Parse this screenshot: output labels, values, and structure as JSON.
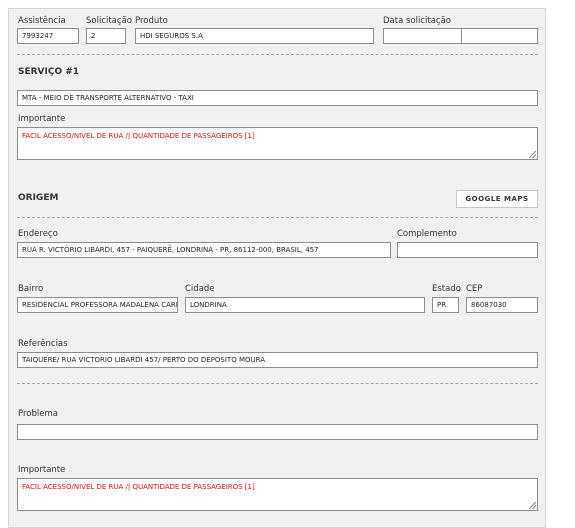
{
  "header": {
    "assistencia_label": "Assistência",
    "assistencia_value": "7993247",
    "solicitacao_label": "Solicitação",
    "solicitacao_value": "2",
    "produto_label": "Produto",
    "produto_value": "HDI SEGUROS S.A",
    "data_label": "Data solicitação",
    "data_value_date": "",
    "data_value_time": ""
  },
  "servico": {
    "title": "SERVIÇO #1",
    "value": "MTA - MEIO DE TRANSPORTE ALTERNATIVO - TAXI",
    "importante_label": "Importante",
    "importante_value": "FACIL ACESSO/NIVEL DE RUA /| QUANTIDADE DE PASSAGEIROS [1]"
  },
  "origem": {
    "title": "ORIGEM",
    "google_maps_label": "GOOGLE MAPS",
    "endereco_label": "Endereço",
    "endereco_value": "RUA R. VICTÓRIO LIBARDI, 457 - PAIQUERÊ, LONDRINA - PR, 86112-000, BRASIL, 457",
    "complemento_label": "Complemento",
    "complemento_value": "",
    "bairro_label": "Bairro",
    "bairro_value": "RESIDENCIAL PROFESSORA MADALENA CARDOSO",
    "cidade_label": "Cidade",
    "cidade_value": "LONDRINA",
    "estado_label": "Estado",
    "estado_value": "PR",
    "cep_label": "CEP",
    "cep_value": "86087030",
    "referencias_label": "Referências",
    "referencias_value": "TAIQUERE/ RUA VICTORIO LIBARDI 457/ PERTO DO DEPOSITO MOURA"
  },
  "problema": {
    "label": "Problema",
    "value": "",
    "importante_label": "Importante",
    "importante_value": "FACIL ACESSO/NIVEL DE RUA /| QUANTIDADE DE PASSAGEIROS [1]"
  },
  "colors": {
    "panel_bg": "#f1f1f1",
    "important_text": "#dd1111",
    "field_border": "#8d8d8d"
  }
}
